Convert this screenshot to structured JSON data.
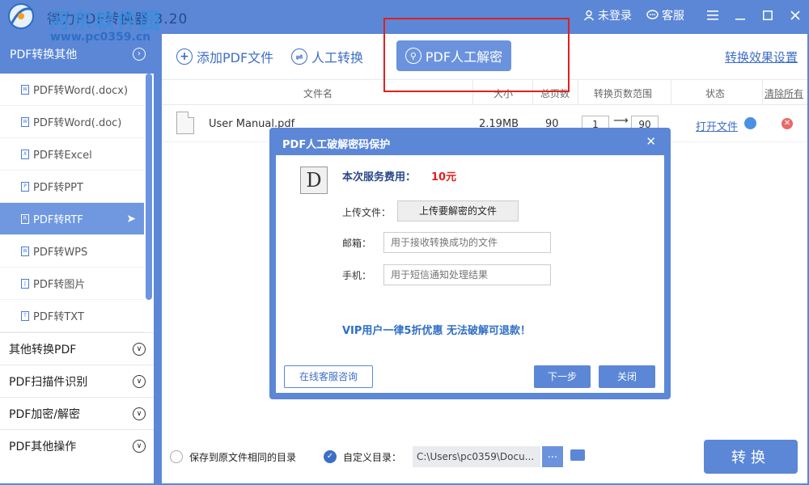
{
  "window": {
    "title": "得力PDF转换器 3.20",
    "watermark_title": "河东软件园",
    "watermark_url": "www.pc0359.cn",
    "login": "未登录",
    "service": "客服"
  },
  "sidebar": {
    "header": "PDF转换其他",
    "items": [
      {
        "label": "PDF转Word(.docx)",
        "badge": "W"
      },
      {
        "label": "PDF转Word(.doc)",
        "badge": "W"
      },
      {
        "label": "PDF转Excel",
        "badge": "X"
      },
      {
        "label": "PDF转PPT",
        "badge": "P"
      },
      {
        "label": "PDF转RTF",
        "badge": "R"
      },
      {
        "label": "PDF转WPS",
        "badge": "W"
      },
      {
        "label": "PDF转图片",
        "badge": "J"
      },
      {
        "label": "PDF转TXT",
        "badge": "T"
      }
    ],
    "categories": [
      "其他转换PDF",
      "PDF扫描件识别",
      "PDF加密/解密",
      "PDF其他操作"
    ]
  },
  "toolbar": {
    "add_pdf": "添加PDF文件",
    "manual_convert": "人工转换",
    "manual_decrypt": "PDF人工解密",
    "effect_settings": "转换效果设置"
  },
  "table": {
    "headers": {
      "name": "文件名",
      "size": "大小",
      "pages": "总页数",
      "range": "转换页数范围",
      "status": "状态",
      "clear": "清除所有"
    },
    "rows": [
      {
        "name": "User Manual.pdf",
        "size": "2.19MB",
        "pages": "90",
        "from": "1",
        "to": "90",
        "action": "打开文件"
      }
    ]
  },
  "bottom": {
    "same_dir": "保存到原文件相同的目录",
    "custom_dir": "自定义目录：",
    "path": "C:\\Users\\pc0359\\Docu...",
    "browse": "...",
    "convert": "转换"
  },
  "dialog": {
    "title": "PDF人工破解密码保护",
    "logo": "D",
    "fee_label": "本次服务费用：",
    "fee_value": "10元",
    "upload_label": "上传文件：",
    "upload_button": "上传要解密的文件",
    "email_label": "邮箱：",
    "email_placeholder": "用于接收转换成功的文件",
    "phone_label": "手机：",
    "phone_placeholder": "用于短信通知处理结果",
    "vip_note": "VIP用户一律5折优惠 无法破解可退款！",
    "consult": "在线客服咨询",
    "next": "下一步",
    "close": "关闭"
  }
}
